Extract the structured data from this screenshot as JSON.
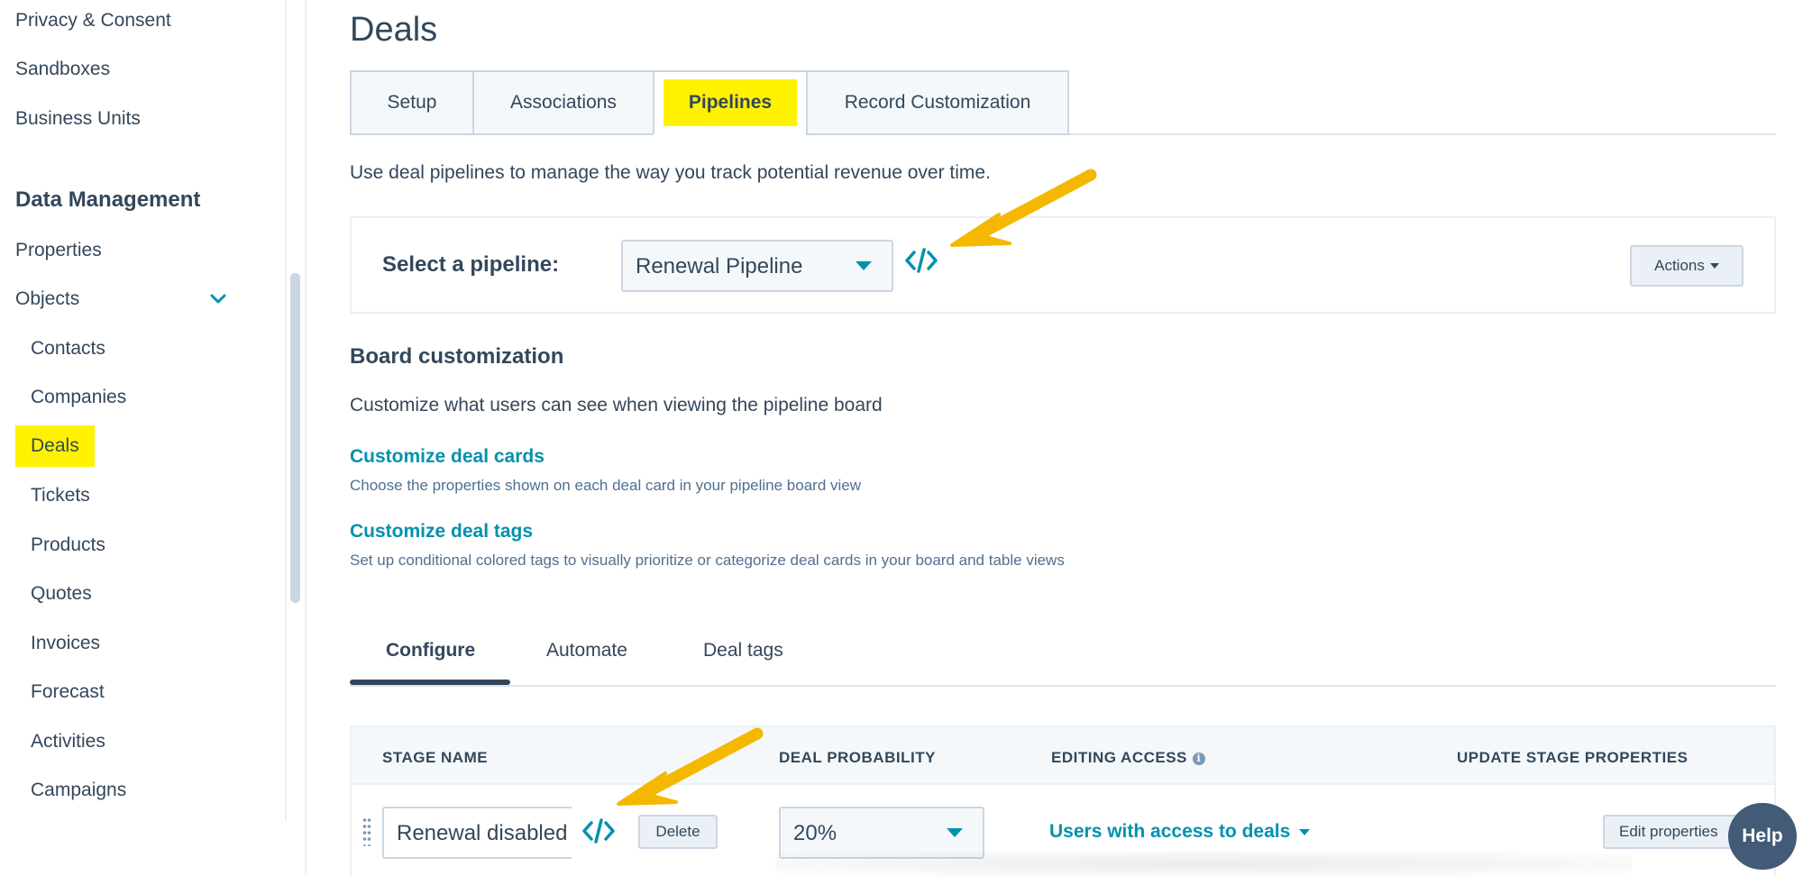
{
  "sidebar": {
    "items_top": [
      "Privacy & Consent",
      "Sandboxes",
      "Business Units"
    ],
    "section_heading": "Data Management",
    "properties": "Properties",
    "objects": "Objects",
    "object_items": [
      "Contacts",
      "Companies",
      "Deals",
      "Tickets",
      "Products",
      "Quotes",
      "Invoices",
      "Forecast",
      "Activities",
      "Campaigns"
    ]
  },
  "main": {
    "title": "Deals",
    "tabs": [
      "Setup",
      "Associations",
      "Pipelines",
      "Record Customization"
    ],
    "intro": "Use deal pipelines to manage the way you track potential revenue over time.",
    "pipeline": {
      "label": "Select a pipeline:",
      "selected": "Renewal Pipeline",
      "actions_label": "Actions"
    },
    "board": {
      "title": "Board customization",
      "description": "Customize what users can see when viewing the pipeline board",
      "cards_link": "Customize deal cards",
      "cards_desc": "Choose the properties shown on each deal card in your pipeline board view",
      "tags_link": "Customize deal tags",
      "tags_desc": "Set up conditional colored tags to visually prioritize or categorize deal cards in your board and table views"
    },
    "subtabs": [
      "Configure",
      "Automate",
      "Deal tags"
    ],
    "table": {
      "headers": [
        "STAGE NAME",
        "DEAL PROBABILITY",
        "EDITING ACCESS",
        "UPDATE STAGE PROPERTIES"
      ],
      "row": {
        "stage_name": "Renewal disabled",
        "delete_label": "Delete",
        "probability": "20%",
        "access": "Users with access to deals",
        "edit_label": "Edit properties"
      }
    },
    "help_label": "Help"
  },
  "colors": {
    "accent": "#0091ae",
    "highlight": "#fff200",
    "text": "#33475b",
    "arrow": "#f5b800"
  }
}
